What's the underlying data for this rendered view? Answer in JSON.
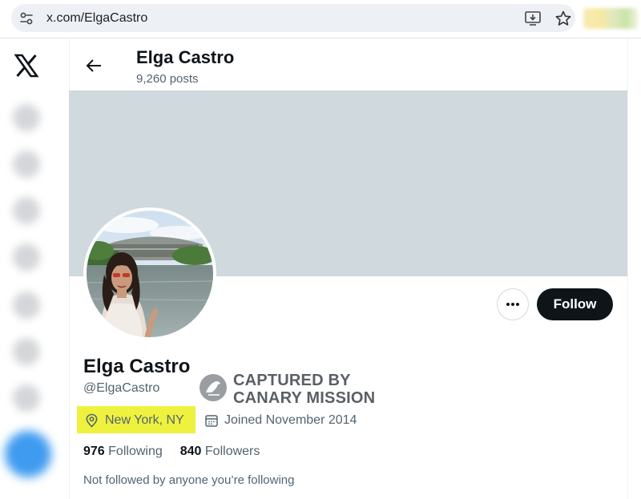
{
  "browser": {
    "url": "x.com/ElgaCastro"
  },
  "nav": {
    "logo_icon": "x-logo-icon",
    "blurred_items": 7,
    "post_button_color": "#3f9bf0"
  },
  "header": {
    "name": "Elga Castro",
    "posts_count": "9,260 posts"
  },
  "profile": {
    "name": "Elga Castro",
    "handle": "@ElgaCastro",
    "location": "New York, NY",
    "joined": "Joined November 2014",
    "following_count": "976",
    "following_label": "Following",
    "followers_count": "840",
    "followers_label": "Followers",
    "followed_by": "Not followed by anyone you’re following"
  },
  "actions": {
    "follow_label": "Follow",
    "more_icon": "more-horizontal-icon"
  },
  "watermark": {
    "line1": "CAPTURED BY",
    "line2": "CANARY MISSION"
  },
  "colors": {
    "banner": "#cfd9de",
    "follow_button": "#0f1419",
    "highlight": "#eef23e",
    "secondary_text": "#536471"
  }
}
